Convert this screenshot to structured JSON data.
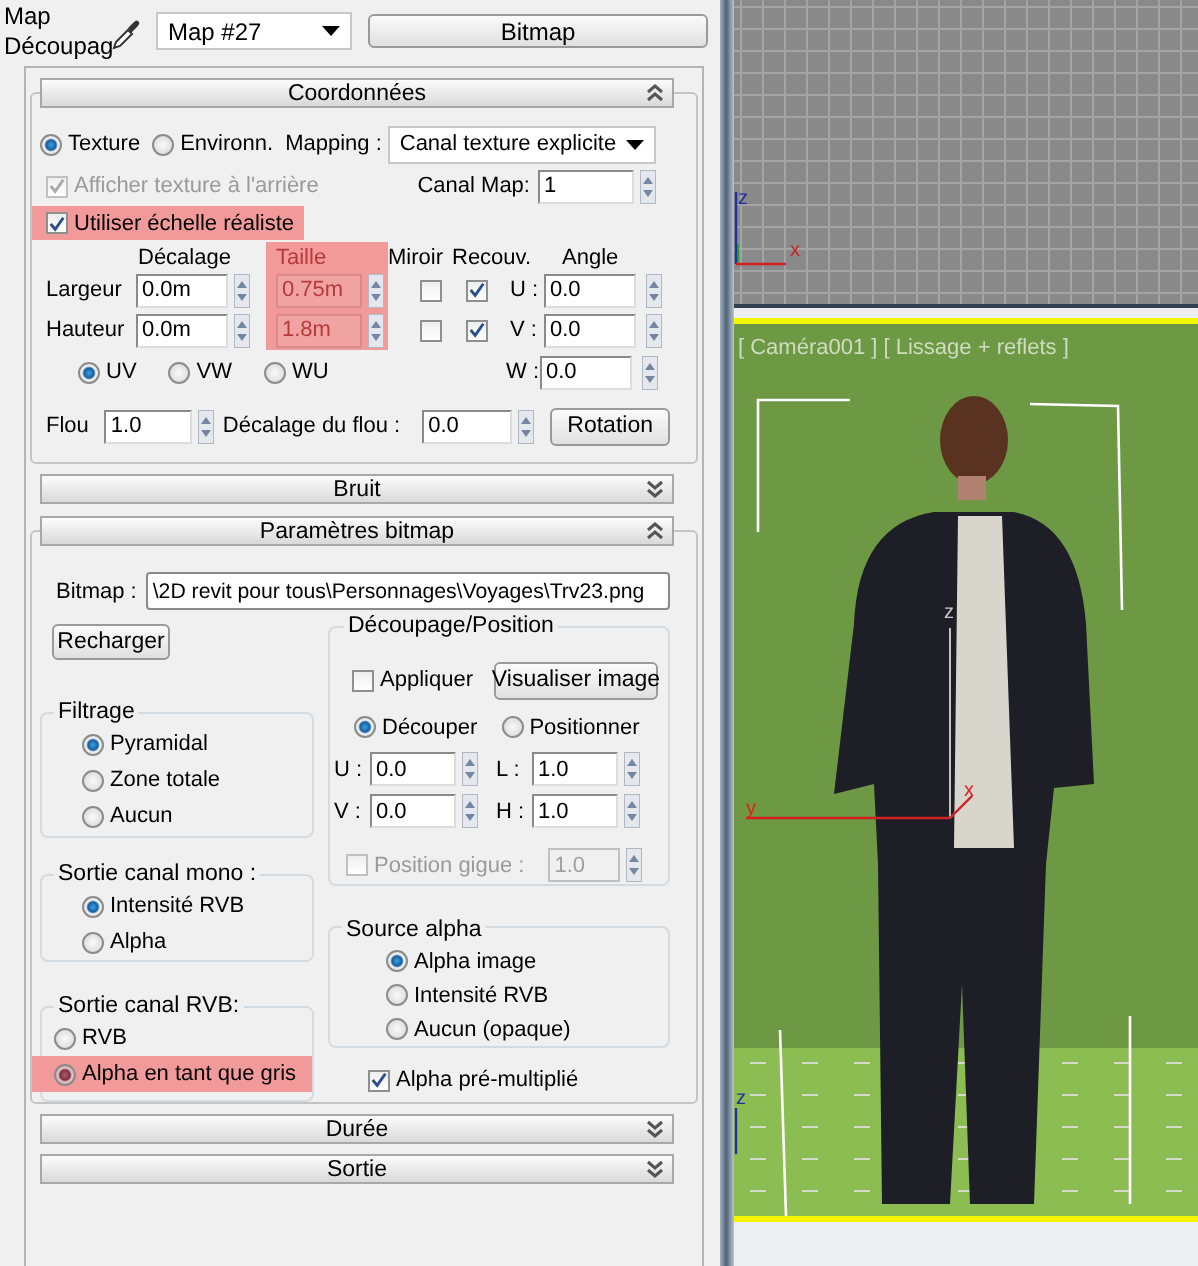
{
  "editor": {
    "label_lines": [
      "Map",
      "Découpag"
    ],
    "map_name": "Map #27",
    "type_button": "Bitmap"
  },
  "rollouts": [
    {
      "kind": "coordinates",
      "title": "Coordonnées",
      "expanded": true,
      "source": [
        {
          "label": "Texture",
          "selected": true
        },
        {
          "label": "Environn.",
          "selected": false
        }
      ],
      "mapping_label": "Mapping :",
      "mapping_value": "Canal texture explicite",
      "show_back": {
        "label": "Afficher texture à l'arrière",
        "checked": true,
        "disabled": true
      },
      "map_channel": {
        "label": "Canal Map:",
        "value": "1"
      },
      "real_world": {
        "label": "Utiliser échelle réaliste",
        "checked": true,
        "highlighted": true
      },
      "columns": [
        {
          "label": "Décalage",
          "highlighted": false
        },
        {
          "label": "Taille",
          "highlighted": true
        },
        {
          "label": "Miroir",
          "highlighted": false
        },
        {
          "label": "Recouv.",
          "highlighted": false
        },
        {
          "label": "Angle",
          "highlighted": false
        }
      ],
      "rows": [
        {
          "label": "Largeur",
          "offset": "0.0m",
          "size": "0.75m",
          "mirror": false,
          "tile": true,
          "angle_label": "U :",
          "angle": "0.0"
        },
        {
          "label": "Hauteur",
          "offset": "0.0m",
          "size": "1.8m",
          "mirror": false,
          "tile": true,
          "angle_label": "V :",
          "angle": "0.0"
        }
      ],
      "planes": [
        {
          "label": "UV",
          "selected": true
        },
        {
          "label": "VW",
          "selected": false
        },
        {
          "label": "WU",
          "selected": false
        }
      ],
      "w_label": "W :",
      "w_angle": "0.0",
      "blur": {
        "label": "Flou",
        "value": "1.0"
      },
      "blur_offset": {
        "label": "Décalage du flou :",
        "value": "0.0"
      },
      "rotation_button": "Rotation"
    },
    {
      "title": "Bruit",
      "expanded": false
    },
    {
      "kind": "bitmap_params",
      "title": "Paramètres bitmap",
      "expanded": true,
      "bitmap_label": "Bitmap :",
      "bitmap_path": "\\2D revit pour tous\\Personnages\\Voyages\\Trv23.png",
      "reload_button": "Recharger",
      "filtering": {
        "title": "Filtrage",
        "options": [
          {
            "label": "Pyramidal",
            "selected": true
          },
          {
            "label": "Zone totale",
            "selected": false
          },
          {
            "label": "Aucun",
            "selected": false
          }
        ]
      },
      "mono_output": {
        "title": "Sortie canal mono :",
        "options": [
          {
            "label": "Intensité RVB",
            "selected": true
          },
          {
            "label": "Alpha",
            "selected": false
          }
        ]
      },
      "rgb_output": {
        "title": "Sortie canal RVB:",
        "options": [
          {
            "label": "RVB",
            "selected": false,
            "highlighted": false
          },
          {
            "label": "Alpha en tant que gris",
            "selected": true,
            "highlighted": true
          }
        ]
      },
      "cropping": {
        "title": "Découpage/Position",
        "apply": {
          "label": "Appliquer",
          "checked": false
        },
        "view_button": "Visualiser image",
        "modes": [
          {
            "label": "Découper",
            "selected": true
          },
          {
            "label": "Positionner",
            "selected": false
          }
        ],
        "fields": [
          {
            "label": "U :",
            "value": "0.0"
          },
          {
            "label": "L :",
            "value": "1.0"
          },
          {
            "label": "V :",
            "value": "0.0"
          },
          {
            "label": "H :",
            "value": "1.0"
          }
        ],
        "jitter": {
          "label": "Position gigue :",
          "checked": false,
          "disabled": true,
          "value": "1.0"
        }
      },
      "alpha_source": {
        "title": "Source alpha",
        "options": [
          {
            "label": "Alpha image",
            "selected": true
          },
          {
            "label": "Intensité RVB",
            "selected": false
          },
          {
            "label": "Aucun (opaque)",
            "selected": false
          }
        ]
      },
      "premultiplied": {
        "label": "Alpha pré-multiplié",
        "checked": true
      }
    },
    {
      "title": "Durée",
      "expanded": false
    },
    {
      "title": "Sortie",
      "expanded": false
    }
  ],
  "viewports": {
    "top_axes": [
      "z",
      "x"
    ],
    "camera_label": "[ Caméra001 ] [ Lissage + reflets ]",
    "camera_axes": [
      "z",
      "x",
      "y"
    ],
    "floor_axes": [
      "z"
    ]
  }
}
